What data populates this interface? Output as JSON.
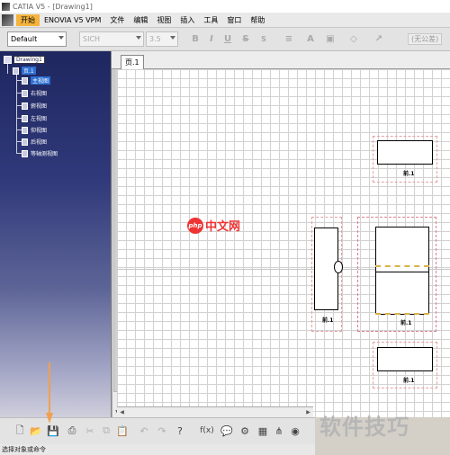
{
  "window": {
    "title": "CATIA V5 - [Drawing1]"
  },
  "menu": [
    "开始",
    "ENOVIA V5 VPM",
    "文件",
    "编辑",
    "视图",
    "插入",
    "工具",
    "窗口",
    "帮助"
  ],
  "toolbar": {
    "style_value": "Default",
    "font_name": "SICH",
    "font_size": "3.5",
    "bold": "B",
    "italic": "I",
    "underline": "U",
    "strike": "S",
    "superscript": "S",
    "no_style": "(无公差)"
  },
  "tree": {
    "root": "Drawing1",
    "sheet": "页.1",
    "views": [
      "主视图",
      "右视图",
      "俯视图",
      "左视图",
      "仰视图",
      "后视图",
      "等轴测视图"
    ]
  },
  "tabs": [
    "页.1"
  ],
  "views": {
    "v1_label": "前.1",
    "v2_label": "前.1",
    "v3_label": "前.1",
    "v4_label": "前.1",
    "v5_label": "前.1"
  },
  "status": {
    "message": "选择对象或命令"
  },
  "watermarks": {
    "php_logo": "php",
    "php_text": "中文网",
    "right": "软件技巧"
  },
  "colors": {
    "tree_bg": "#2a3272",
    "selected_menu": "#f3b33d",
    "arrow": "#f0a050"
  }
}
